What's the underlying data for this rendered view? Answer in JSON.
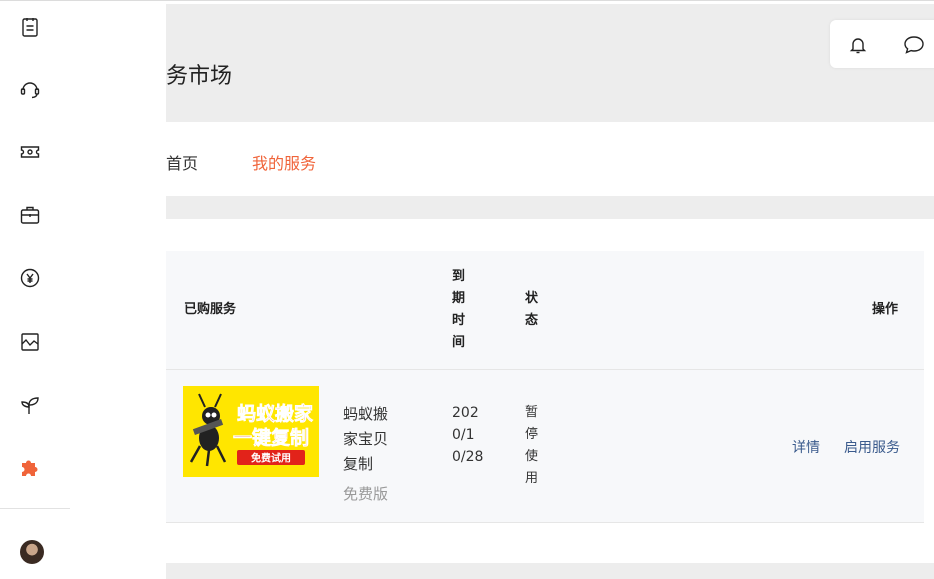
{
  "header": {
    "title": "务市场"
  },
  "tabs": [
    {
      "label": "首页",
      "active": false
    },
    {
      "label": "我的服务",
      "active": true
    }
  ],
  "table": {
    "columns": {
      "service": "已购服务",
      "expire": "到期时间",
      "status": "状态",
      "action": "操作"
    },
    "rows": [
      {
        "thumb_line1": "蚂蚁搬家",
        "thumb_line2": "一键复制",
        "thumb_badge": "免费试用",
        "name": "蚂蚁搬家宝贝复制",
        "version": "免费版",
        "expire": "2020/10/28",
        "status": "暂停使用",
        "detail_label": "详情",
        "enable_label": "启用服务"
      }
    ]
  },
  "sidebar": {
    "icons": [
      "clipboard-icon",
      "headset-icon",
      "ticket-icon",
      "briefcase-icon",
      "yen-coin-icon",
      "image-chart-icon",
      "sprout-icon",
      "puzzle-icon"
    ]
  },
  "colors": {
    "accent": "#f0643a",
    "link": "#3a5a8c",
    "header_bg": "#ededed",
    "table_bg": "#f7f8fa"
  }
}
